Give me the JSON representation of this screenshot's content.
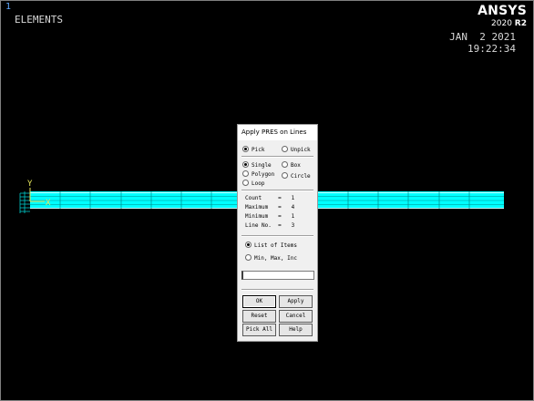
{
  "window": {
    "number": "1",
    "title": "ELEMENTS"
  },
  "logo": {
    "name": "ANSYS",
    "version": "2020",
    "release": "R2"
  },
  "datetime": {
    "date": "JAN  2 2021",
    "time": "19:22:34"
  },
  "triad": {
    "y_label": "Y",
    "x_label": "X"
  },
  "colors": {
    "background": "#000000",
    "beam": "#00ffff",
    "triad": "#e6e65a",
    "dialog": "#f0f0f0"
  },
  "dialog": {
    "title": "Apply PRES on Lines",
    "pick_mode": {
      "pick": "Pick",
      "unpick": "Unpick",
      "selected": "Pick"
    },
    "pick_shape": {
      "single": "Single",
      "box": "Box",
      "polygon": "Polygon",
      "circle": "Circle",
      "loop": "Loop",
      "selected": "Single"
    },
    "info": {
      "count": "Count     =   1",
      "maximum": "Maximum   =   4",
      "minimum": "Minimum   =   1",
      "line_no": "Line No.  =   3"
    },
    "entry_mode": {
      "list": "List of Items",
      "minmax": "Min, Max, Inc",
      "selected": "List of Items"
    },
    "input_value": "",
    "buttons": {
      "ok": "OK",
      "apply": "Apply",
      "reset": "Reset",
      "cancel": "Cancel",
      "pick_all": "Pick All",
      "help": "Help"
    }
  }
}
